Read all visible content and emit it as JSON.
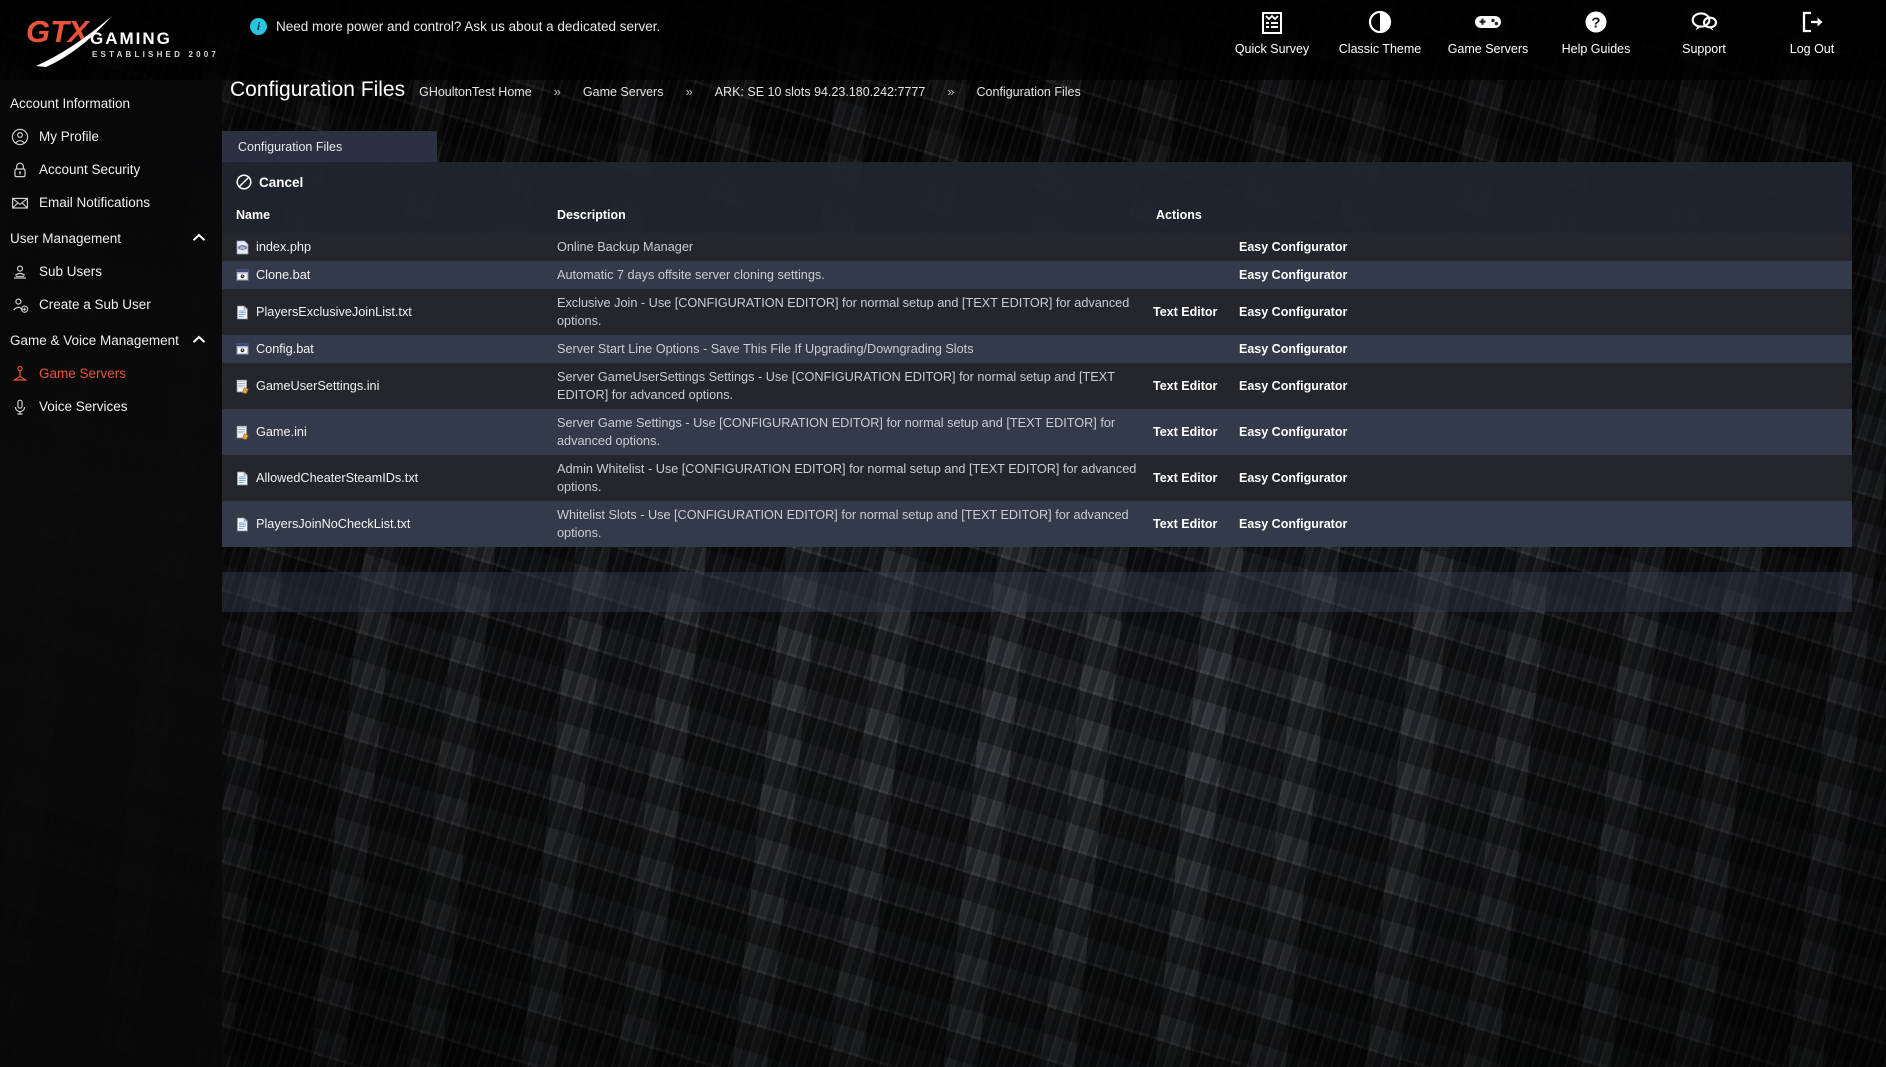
{
  "brand": {
    "name": "GTX",
    "word": "GAMING",
    "tagline": "ESTABLISHED 2007",
    "accent": "#e8543a"
  },
  "topbar": {
    "info_icon": "info-circle-icon",
    "info_message": "Need more power and control? Ask us about a dedicated server.",
    "nav": [
      {
        "label": "Quick Survey",
        "icon": "clipboard-icon"
      },
      {
        "label": "Classic Theme",
        "icon": "contrast-circle-icon"
      },
      {
        "label": "Game Servers",
        "icon": "gamepad-icon"
      },
      {
        "label": "Help Guides",
        "icon": "question-circle-icon"
      },
      {
        "label": "Support",
        "icon": "chat-bubbles-icon"
      },
      {
        "label": "Log Out",
        "icon": "logout-icon"
      }
    ]
  },
  "sidebar": {
    "groups": [
      {
        "label": "Account Information",
        "collapsible": false,
        "items": [
          {
            "label": "My Profile",
            "icon": "user-circle-icon",
            "active": false
          },
          {
            "label": "Account Security",
            "icon": "lock-icon",
            "active": false
          },
          {
            "label": "Email Notifications",
            "icon": "envelope-icon",
            "active": false
          }
        ]
      },
      {
        "label": "User Management",
        "collapsible": true,
        "chevron": "chevron-up-icon",
        "items": [
          {
            "label": "Sub Users",
            "icon": "users-icon",
            "active": false
          },
          {
            "label": "Create a Sub User",
            "icon": "user-add-icon",
            "active": false
          }
        ]
      },
      {
        "label": "Game & Voice Management",
        "collapsible": true,
        "chevron": "chevron-up-icon",
        "items": [
          {
            "label": "Game Servers",
            "icon": "joystick-icon",
            "active": true
          },
          {
            "label": "Voice Services",
            "icon": "microphone-icon",
            "active": false
          }
        ]
      }
    ]
  },
  "page": {
    "title": "Configuration Files",
    "breadcrumb": [
      "GHoultonTest Home",
      "Game Servers",
      "ARK: SE 10 slots 94.23.180.242:7777",
      "Configuration Files"
    ],
    "breadcrumb_separator": "»"
  },
  "panel": {
    "tab_label": "Configuration Files",
    "cancel_label": "Cancel",
    "cancel_icon": "no-entry-icon",
    "columns": {
      "name": "Name",
      "description": "Description",
      "actions": "Actions"
    },
    "action_labels": {
      "text_editor": "Text Editor",
      "easy_configurator": "Easy Configurator"
    },
    "rows": [
      {
        "name": "index.php",
        "icon": "php-file-icon",
        "description": "Online Backup Manager",
        "has_text_editor": false,
        "has_easy_configurator": true
      },
      {
        "name": "Clone.bat",
        "icon": "bat-file-icon",
        "description": "Automatic 7 days offsite server cloning settings.",
        "has_text_editor": false,
        "has_easy_configurator": true
      },
      {
        "name": "PlayersExclusiveJoinList.txt",
        "icon": "txt-file-icon",
        "description": "Exclusive Join - Use [CONFIGURATION EDITOR] for normal setup and [TEXT EDITOR] for advanced options.",
        "has_text_editor": true,
        "has_easy_configurator": true
      },
      {
        "name": "Config.bat",
        "icon": "bat-file-icon",
        "description": "Server Start Line Options - Save This File If Upgrading/Downgrading Slots",
        "has_text_editor": false,
        "has_easy_configurator": true
      },
      {
        "name": "GameUserSettings.ini",
        "icon": "ini-file-icon",
        "description": "Server GameUserSettings Settings - Use [CONFIGURATION EDITOR] for normal setup and [TEXT EDITOR] for advanced options.",
        "has_text_editor": true,
        "has_easy_configurator": true
      },
      {
        "name": "Game.ini",
        "icon": "ini-file-icon",
        "description": "Server Game Settings - Use [CONFIGURATION EDITOR] for normal setup and [TEXT EDITOR] for advanced options.",
        "has_text_editor": true,
        "has_easy_configurator": true
      },
      {
        "name": "AllowedCheaterSteamIDs.txt",
        "icon": "txt-file-icon",
        "description": "Admin Whitelist - Use [CONFIGURATION EDITOR] for normal setup and [TEXT EDITOR] for advanced options.",
        "has_text_editor": true,
        "has_easy_configurator": true
      },
      {
        "name": "PlayersJoinNoCheckList.txt",
        "icon": "txt-file-icon",
        "description": "Whitelist Slots - Use [CONFIGURATION EDITOR] for normal setup and [TEXT EDITOR] for advanced options.",
        "has_text_editor": true,
        "has_easy_configurator": true
      }
    ]
  }
}
